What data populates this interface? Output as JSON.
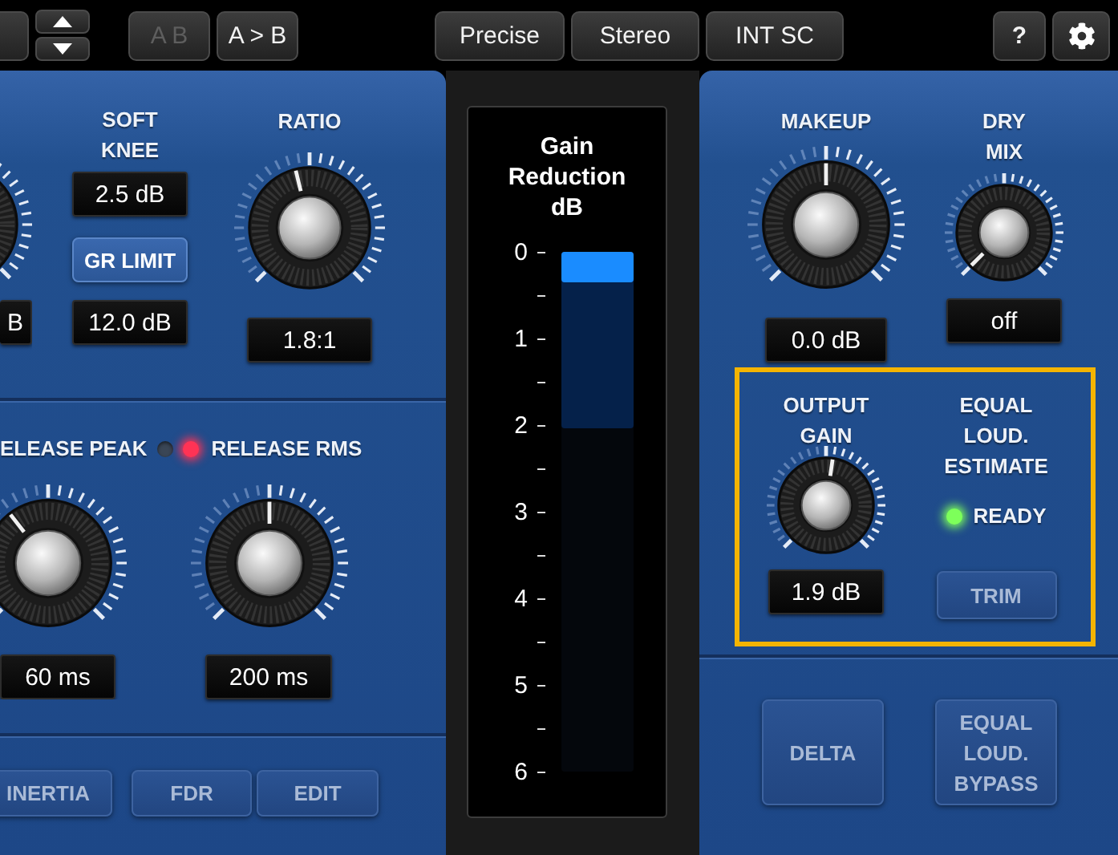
{
  "toolbar": {
    "ab_button": {
      "label": "A B",
      "disabled": true
    },
    "copy_button": {
      "label": "A > B",
      "disabled": false
    },
    "mode_buttons": [
      {
        "label": "Precise"
      },
      {
        "label": "Stereo"
      },
      {
        "label": "INT SC"
      }
    ],
    "help_button": {
      "label": "?"
    }
  },
  "compressor": {
    "partial_value": "B",
    "soft_knee": {
      "label": "SOFT\nKNEE",
      "value": "2.5 dB"
    },
    "gr_limit": {
      "label": "GR LIMIT",
      "on": true,
      "value": "12.0 dB"
    },
    "ratio": {
      "label": "RATIO",
      "level": 0.45,
      "value": "1.8:1"
    },
    "release": {
      "peak_label": "ELEASE PEAK",
      "rms_label": "RELEASE RMS",
      "leds": [
        {
          "on": false
        },
        {
          "on": true
        }
      ],
      "knobs": [
        {
          "level": 0.36,
          "value": "60 ms"
        },
        {
          "level": 0.5,
          "value": "200 ms"
        }
      ]
    },
    "buttons": [
      {
        "label": "INERTIA",
        "on": false
      },
      {
        "label": "FDR",
        "on": false
      },
      {
        "label": "EDIT",
        "on": false
      }
    ]
  },
  "meter": {
    "title": "Gain\nReduction\ndB",
    "scale": [
      "0",
      "1",
      "2",
      "3",
      "4",
      "5",
      "6"
    ],
    "bars": [
      {
        "kind": "hold",
        "level": 0.34
      },
      {
        "kind": "current",
        "level": 0.06
      }
    ]
  },
  "output": {
    "makeup": {
      "label": "MAKEUP",
      "level": 0.5,
      "value": "0.0 dB"
    },
    "dry_mix": {
      "label": "DRY\nMIX",
      "level": 0.0,
      "value": "off"
    },
    "loudness": {
      "highlighted": true,
      "output_gain": {
        "label": "OUTPUT\nGAIN",
        "level": 0.53,
        "value": "1.9 dB"
      },
      "estimate": {
        "label": "EQUAL\nLOUD.\nESTIMATE",
        "led_on": true,
        "status": "READY",
        "trim": {
          "label": "TRIM",
          "on": false
        }
      }
    },
    "buttons": [
      {
        "label": "DELTA",
        "on": false
      },
      {
        "label": "EQUAL\nLOUD.\nBYPASS",
        "on": false
      }
    ]
  }
}
